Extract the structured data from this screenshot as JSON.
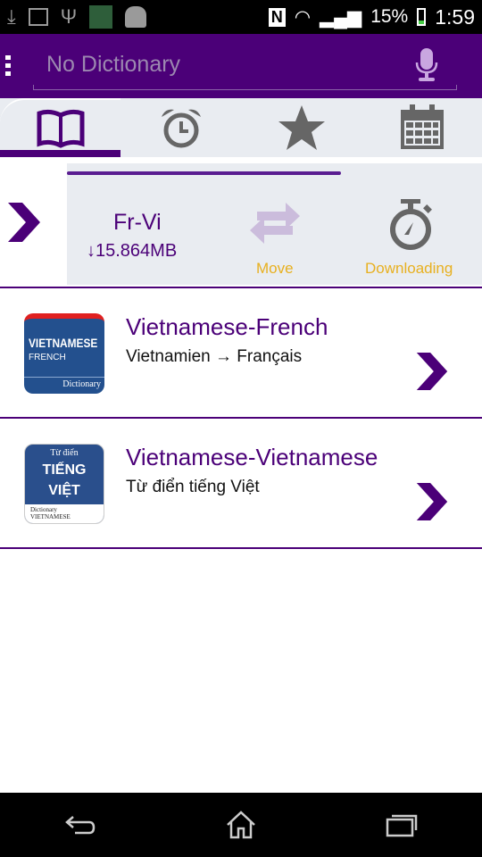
{
  "status_bar": {
    "battery": "15%",
    "time": "1:59",
    "icons": [
      "download-icon",
      "image-icon",
      "usb-icon",
      "app-icon",
      "android-icon",
      "nfc-icon",
      "wifi-icon",
      "signal-icon",
      "battery-icon"
    ]
  },
  "search": {
    "placeholder": "No Dictionary"
  },
  "tabs": [
    {
      "icon": "book-icon",
      "active": true
    },
    {
      "icon": "alarm-icon"
    },
    {
      "icon": "star-icon"
    },
    {
      "icon": "calendar-icon"
    }
  ],
  "download": {
    "name": "Fr-Vi",
    "size": "↓15.864MB",
    "progress_percent": 66,
    "move_label": "Move",
    "status_label": "Downloading"
  },
  "dictionaries": [
    {
      "title": "Vietnamese-French",
      "subtitle": "Vietnamien → Français",
      "icon_text": [
        "VIETNAMESE",
        "FRENCH",
        "Dictionary"
      ]
    },
    {
      "title": "Vietnamese-Vietnamese",
      "subtitle": "Từ điển tiếng Việt",
      "icon_text": [
        "Từ điển",
        "TIẾNG",
        "VIỆT",
        "Dictionary",
        "VIETNAMESE"
      ]
    }
  ],
  "colors": {
    "primary": "#4b0078",
    "accent": "#e8b020",
    "panel": "#e9ecf1"
  }
}
